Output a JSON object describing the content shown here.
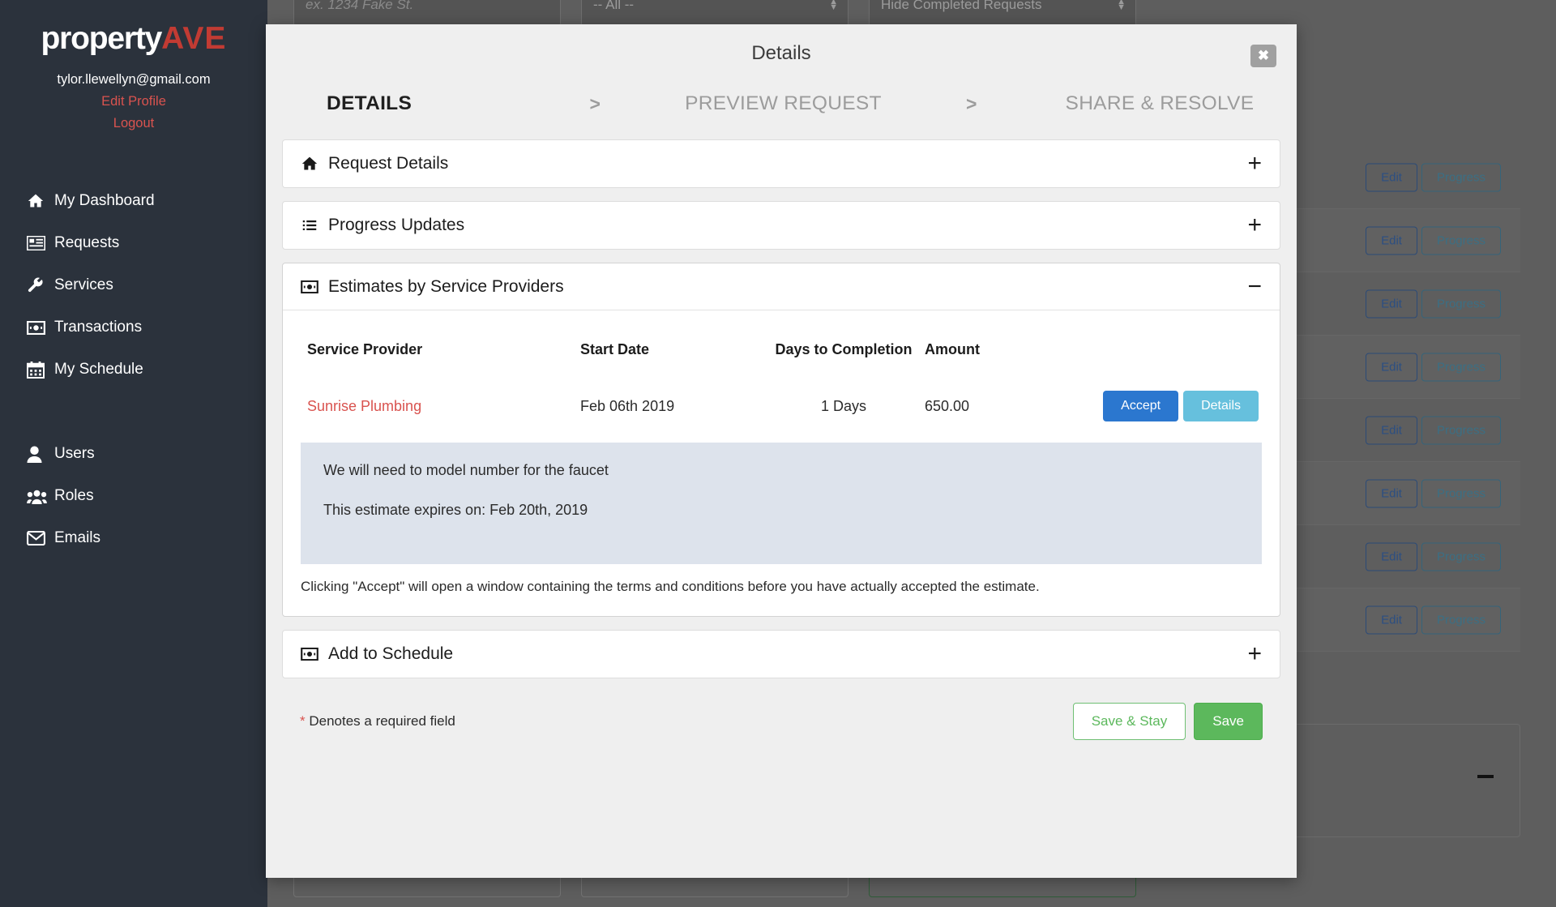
{
  "sidebar": {
    "logo": {
      "part1": "property",
      "part2": "AVE"
    },
    "user_email": "tylor.llewellyn@gmail.com",
    "edit_profile": "Edit Profile",
    "logout": "Logout",
    "primary_nav": [
      {
        "label": "My Dashboard",
        "icon": "home-icon"
      },
      {
        "label": "Requests",
        "icon": "list-card-icon"
      },
      {
        "label": "Services",
        "icon": "wrench-icon"
      },
      {
        "label": "Transactions",
        "icon": "money-icon"
      },
      {
        "label": "My Schedule",
        "icon": "calendar-icon"
      }
    ],
    "secondary_nav": [
      {
        "label": "Users",
        "icon": "user-icon"
      },
      {
        "label": "Roles",
        "icon": "users-group-icon"
      },
      {
        "label": "Emails",
        "icon": "envelope-icon"
      }
    ],
    "colors": {
      "bg": "#2b323c",
      "accent": "#d9534f",
      "logo_accent": "#c23b33"
    }
  },
  "background": {
    "filters": {
      "address_placeholder": "ex. 1234 Fake St.",
      "category_value": "-- All --",
      "completed_value": "Hide Completed Requests"
    },
    "row_actions": {
      "edit": "Edit",
      "progress": "Progress"
    },
    "row_count": 8,
    "collapse_toggle": "−"
  },
  "modal": {
    "title": "Details",
    "close_label": "✖",
    "wizard": {
      "step1": "DETAILS",
      "sep1": ">",
      "step2": "PREVIEW REQUEST",
      "sep2": ">",
      "step3": "SHARE & RESOLVE"
    },
    "accordions": [
      {
        "title": "Request Details",
        "icon": "home-icon",
        "toggle": "+",
        "open": false
      },
      {
        "title": "Progress Updates",
        "icon": "list-icon",
        "toggle": "+",
        "open": false
      },
      {
        "title": "Estimates by Service Providers",
        "icon": "money-icon",
        "toggle": "−",
        "open": true
      },
      {
        "title": "Add to Schedule",
        "icon": "money-icon",
        "toggle": "+",
        "open": false
      }
    ],
    "estimates": {
      "columns": {
        "provider": "Service Provider",
        "start_date": "Start Date",
        "days": "Days to Completion",
        "amount": "Amount"
      },
      "rows": [
        {
          "provider": "Sunrise Plumbing",
          "start_date": "Feb 06th 2019",
          "days": "1 Days",
          "amount": "650.00",
          "accept_label": "Accept",
          "details_label": "Details"
        }
      ],
      "note_line1": "We will need to model number for the faucet",
      "note_line2": "This estimate expires on: Feb 20th, 2019",
      "footnote": "Clicking \"Accept\" will open a window containing the terms and conditions before you have actually accepted the estimate."
    },
    "footer": {
      "required_star": "*",
      "required_text": " Denotes a required field",
      "save_stay": "Save & Stay",
      "save": "Save"
    },
    "colors": {
      "accept": "#2b77cf",
      "details": "#66c0dd",
      "note_bg": "#dde3ec",
      "save": "#5cb85c"
    }
  }
}
